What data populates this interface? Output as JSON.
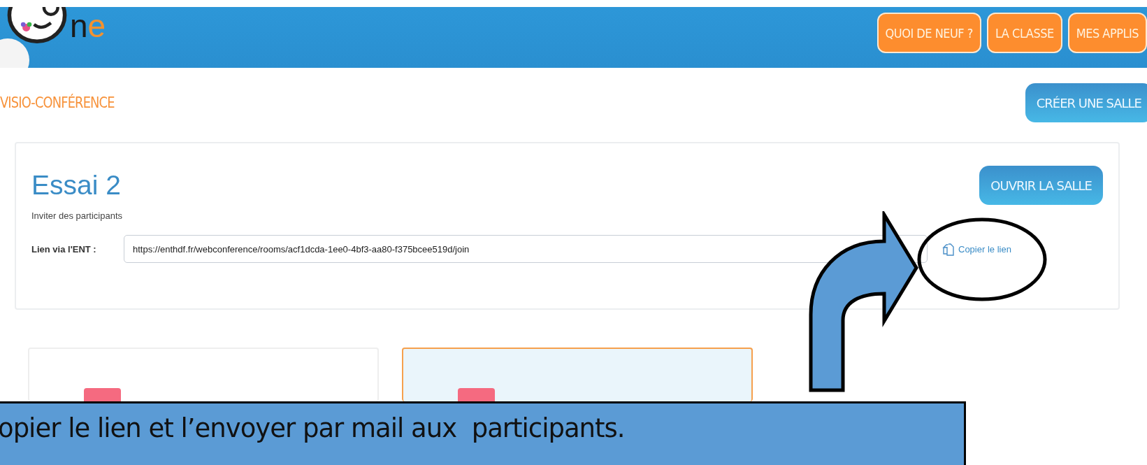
{
  "header": {
    "logo": [
      "n",
      "e"
    ],
    "nav": [
      {
        "label": "QUOI DE NEUF ?"
      },
      {
        "label": "LA CLASSE"
      },
      {
        "label": "MES APPLIS"
      }
    ]
  },
  "page_title": "VISIO-CONFÉRENCE",
  "create_button": "CRÉER UNE SALLE",
  "room": {
    "title": "Essai 2",
    "open_button": "OUVRIR LA SALLE",
    "invite_label": "Inviter des participants",
    "link_label": "Lien via l'ENT :",
    "link_value": "https://enthdf.fr/webconference/rooms/acf1dcda-1ee0-4bf3-aa80-f375bcee519d/join",
    "copy_link": "Copier le lien"
  },
  "cards": [
    {
      "selected": false
    },
    {
      "selected": true
    }
  ],
  "annotation": {
    "text": "opier le lien et l’envoyer par mail aux  participants."
  }
}
